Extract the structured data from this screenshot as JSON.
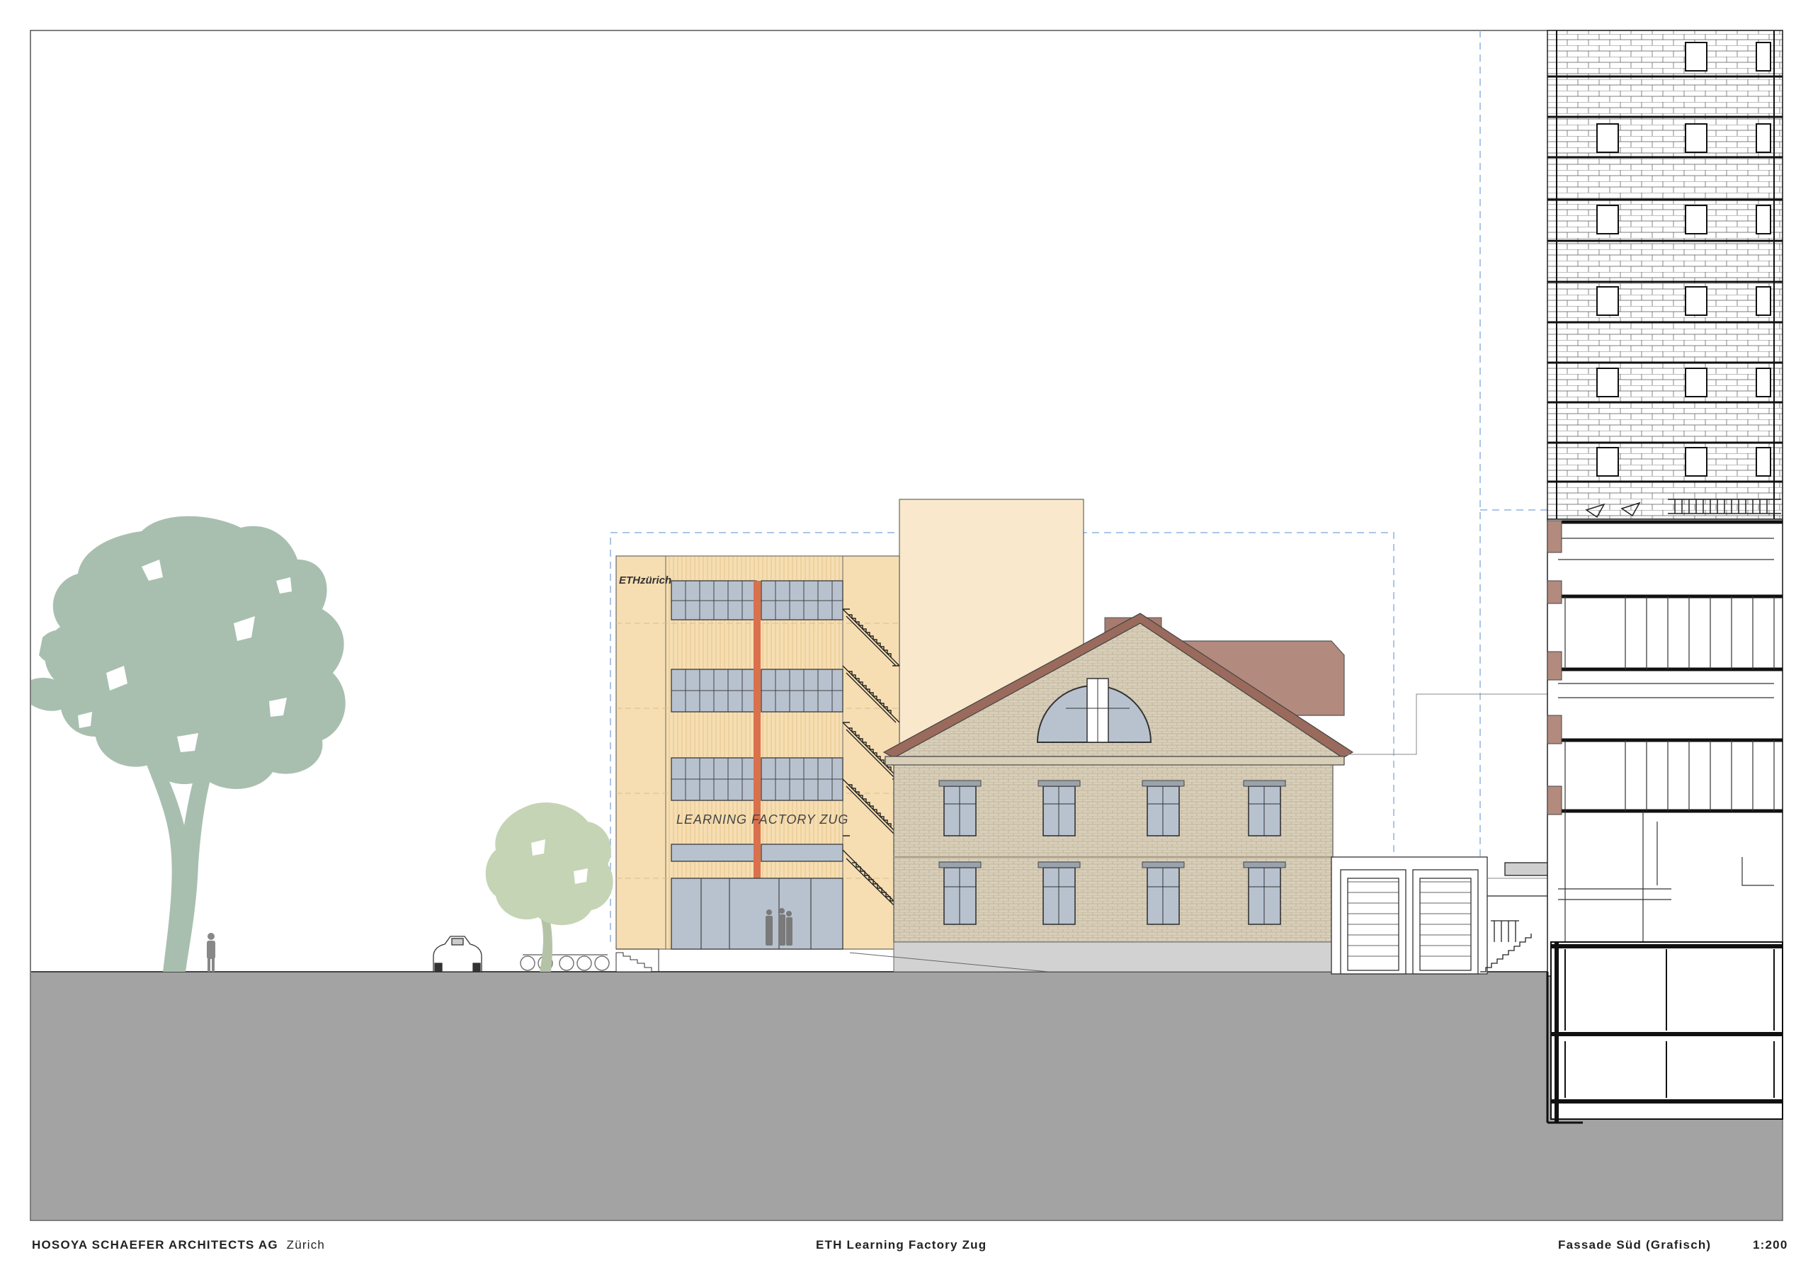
{
  "title_block": {
    "office": "HOSOYA SCHAEFER ARCHITECTS AG",
    "city": "Zürich",
    "project": "ETH Learning Factory Zug",
    "drawing": "Fassade Süd (Grafisch)",
    "scale": "1:200"
  },
  "facade_text": {
    "logo": "ETHzürich",
    "sign": "LEARNING FACTORY ZUG"
  },
  "colors": {
    "ground": "#a3a3a3",
    "new_building": "#f6deb2",
    "rear_volume": "#f9e8cc",
    "accent_red": "#d9714d",
    "roof": "#b38a7e",
    "brick": "#d9cfb9",
    "tree": "#a8bfb0",
    "small_tree": "#c5d4b4",
    "glass": "#b8c2cf",
    "guide": "#8fb3e0"
  }
}
